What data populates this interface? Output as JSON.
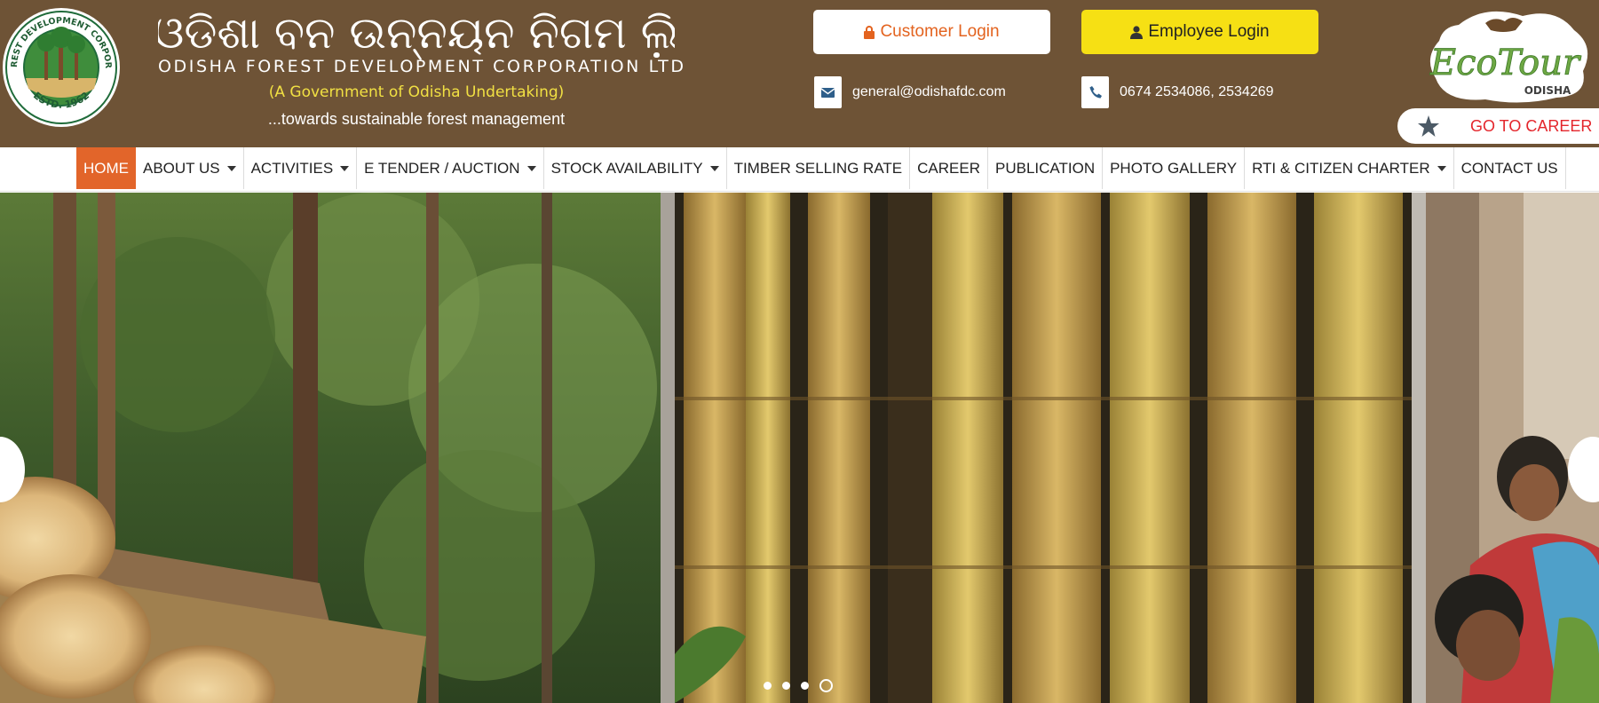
{
  "header": {
    "title_odia": "ଓଡିଶା ବନ ଉନ୍ନୟନ ନିଗମ ଲି଼",
    "title_en": "ODISHA FOREST DEVELOPMENT CORPORATION LTD",
    "subtitle": "(A Government of Odisha Undertaking)",
    "tagline": "...towards sustainable forest management",
    "seal": {
      "ring_text": "ODISHA FOREST DEVELOPMENT CORPORATION LTD.",
      "estd": "ESTD. 1962"
    },
    "customer_login": {
      "label": "Customer Login",
      "icon": "lock-icon"
    },
    "employee_login": {
      "label": "Employee Login",
      "icon": "user-icon"
    },
    "email": {
      "text": "general@odishafdc.com",
      "icon": "envelope-icon"
    },
    "phone": {
      "text": "0674 2534086, 2534269",
      "icon": "phone-icon"
    },
    "ecotour": {
      "line1": "EcoTour",
      "line2": "ODISHA"
    },
    "career_button": {
      "label": "GO TO CAREER",
      "icon": "star-icon"
    }
  },
  "nav": {
    "items": [
      {
        "label": "HOME",
        "active": true,
        "dropdown": false
      },
      {
        "label": "ABOUT US",
        "dropdown": true
      },
      {
        "label": "ACTIVITIES",
        "dropdown": true
      },
      {
        "label": "E TENDER / AUCTION",
        "dropdown": true
      },
      {
        "label": "STOCK AVAILABILITY",
        "dropdown": true
      },
      {
        "label": "TIMBER SELLING RATE",
        "dropdown": false
      },
      {
        "label": "CAREER",
        "dropdown": false
      },
      {
        "label": "PUBLICATION",
        "dropdown": false
      },
      {
        "label": "PHOTO GALLERY",
        "dropdown": false
      },
      {
        "label": "RTI & CITIZEN CHARTER",
        "dropdown": true
      },
      {
        "label": "CONTACT US",
        "dropdown": false
      }
    ]
  },
  "slider": {
    "slides": [
      "forest-logs-image",
      "bamboo-poles-image",
      "women-workers-image"
    ],
    "dot_count": 4,
    "active_dot": 4
  },
  "colors": {
    "header_bg": "#6e5336",
    "accent_orange": "#e2652a",
    "employee_yellow": "#f6e014",
    "subtitle_yellow": "#f1e043",
    "career_red": "#e4262c"
  }
}
